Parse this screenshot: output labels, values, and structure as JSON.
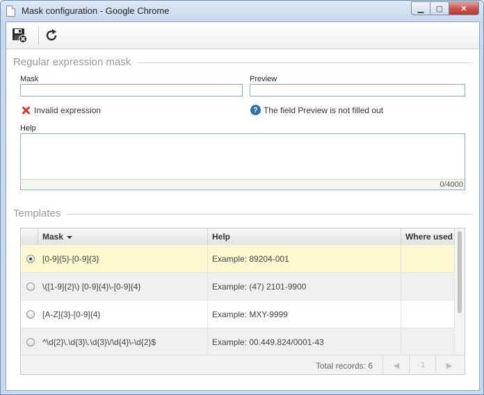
{
  "window": {
    "title": "Mask configuration - Google Chrome"
  },
  "icons": {
    "save": "save-close-icon",
    "refresh": "refresh-icon",
    "invalid": "x-icon",
    "help": "question-icon"
  },
  "regex_section": {
    "title": "Regular expression mask",
    "mask_label": "Mask",
    "mask_value": "",
    "preview_label": "Preview",
    "preview_value": "",
    "invalid_msg": "Invalid expression",
    "preview_msg": "The field Preview is not filled out",
    "help_label": "Help",
    "help_value": "",
    "counter": "0/4000"
  },
  "templates": {
    "title": "Templates",
    "columns": {
      "mask": "Mask",
      "help": "Help",
      "where_used": "Where used"
    },
    "rows": [
      {
        "mask": "[0-9]{5}-[0-9]{3}",
        "help": "Example: 89204-001",
        "where_used": "",
        "selected": true
      },
      {
        "mask": "\\([1-9]{2}\\) [0-9]{4}\\-[0-9]{4}",
        "help": "Example: (47) 2101-9900",
        "where_used": "",
        "selected": false
      },
      {
        "mask": "[A-Z]{3}-[0-9]{4}",
        "help": "Example: MXY-9999",
        "where_used": "",
        "selected": false
      },
      {
        "mask": "^\\d{2}\\.\\d{3}\\.\\d{3}\\/\\d{4}\\-\\d{2}$",
        "help": "Example: 00.449.824/0001-43",
        "where_used": "",
        "selected": false
      }
    ],
    "total_records": "Total records: 6",
    "page": "1"
  },
  "colors": {
    "accent": "#2c6fb5",
    "error": "#d33b2c",
    "selected_row": "#fcf9d0"
  }
}
